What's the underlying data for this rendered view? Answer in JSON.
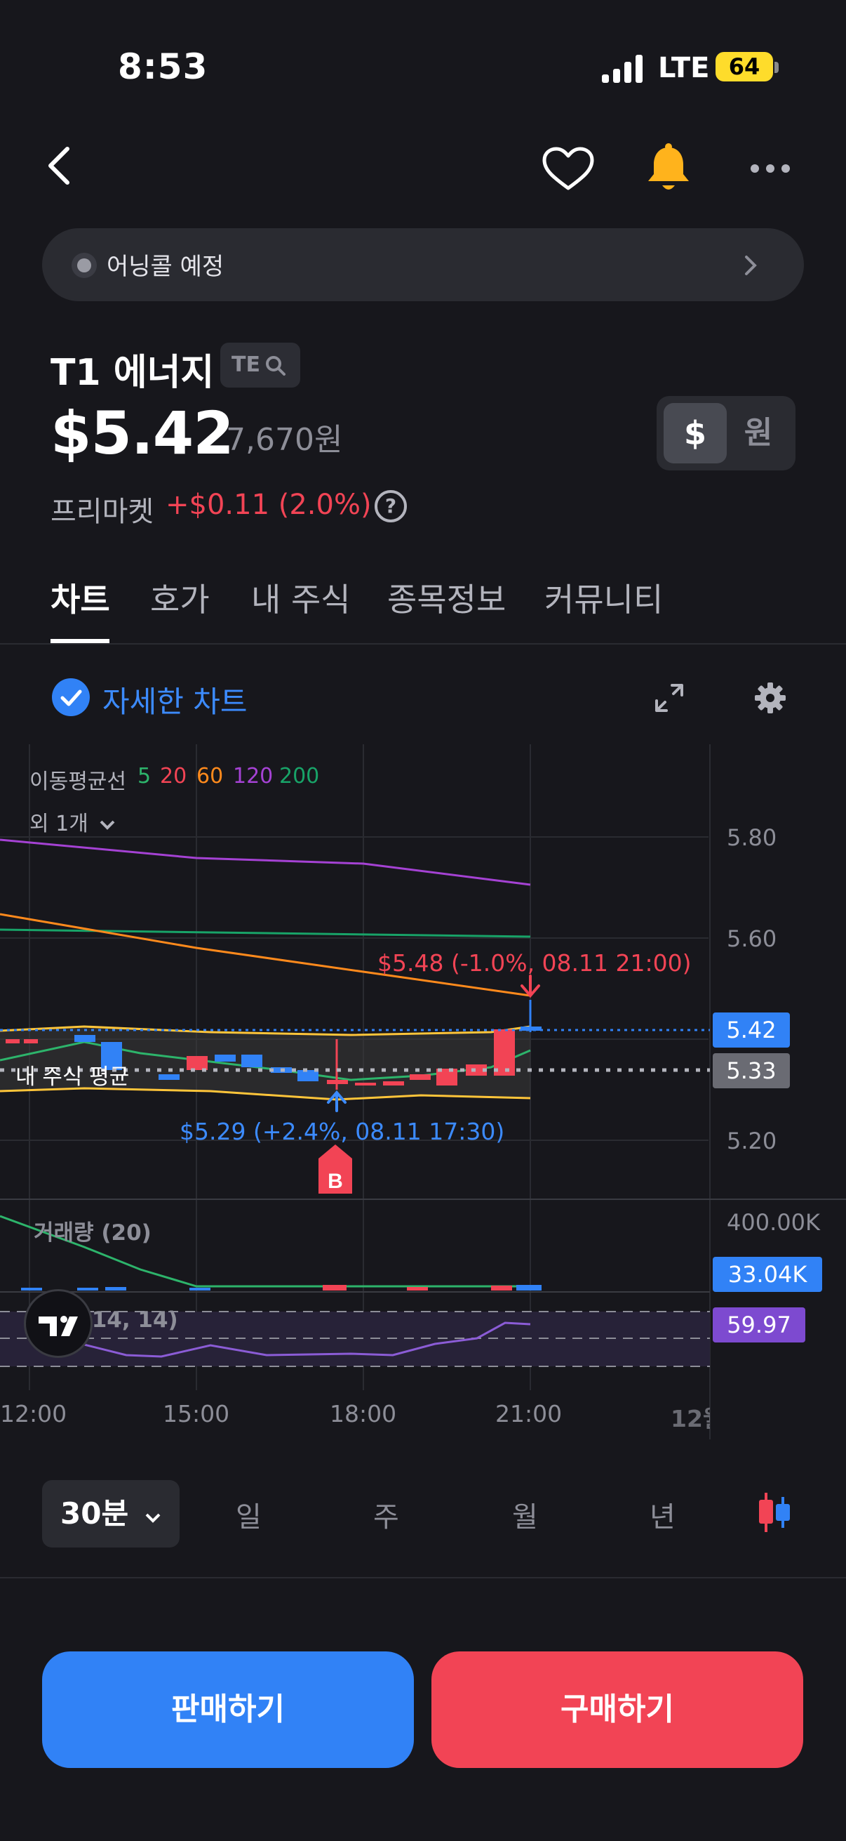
{
  "status_bar": {
    "time": "8:53",
    "network": "LTE",
    "battery": "64"
  },
  "banner": {
    "text": "어닝콜 예정"
  },
  "stock": {
    "name": "T1 에너지",
    "ticker": "TE",
    "price": "$5.42",
    "price_krw": "7,670원",
    "premarket_label": "프리마켓",
    "premarket_change": "+$0.11 (2.0%)"
  },
  "currency": {
    "dollar": "$",
    "won": "원"
  },
  "tabs": [
    {
      "label": "차트"
    },
    {
      "label": "호가"
    },
    {
      "label": "내 주식"
    },
    {
      "label": "종목정보"
    },
    {
      "label": "커뮤니티"
    }
  ],
  "chart_toolbar": {
    "detail_label": "자세한 차트"
  },
  "indicators": {
    "ma_title": "이동평균선",
    "ma_periods": [
      {
        "label": "5",
        "color": "#2db46b"
      },
      {
        "label": "20",
        "color": "#f24455"
      },
      {
        "label": "60",
        "color": "#ff8a1c"
      },
      {
        "label": "120",
        "color": "#a542d4"
      },
      {
        "label": "200",
        "color": "#18a368"
      }
    ],
    "more": "외 1개"
  },
  "chart_data": {
    "type": "candlestick",
    "price_axis": [
      "5.80",
      "5.60",
      "5.20"
    ],
    "current_price_tag": "5.42",
    "avg_price_tag": "5.33",
    "my_avg_label": "내 주식 평균",
    "high_annotation": "$5.48 (-1.0%, 08.11 21:00)",
    "low_annotation": "$5.29 (+2.4%, 08.11 17:30)",
    "buy_marker": "B",
    "volume": {
      "title": "거래량 (20)",
      "axis_max": "400.00K",
      "current_tag": "33.04K"
    },
    "rsi": {
      "title": "RSI (14, 14)",
      "current_tag": "59.97"
    },
    "time_axis": [
      "12:00",
      "15:00",
      "18:00",
      "21:00",
      "12월"
    ],
    "colors": {
      "up": "#f24455",
      "down": "#3182f6"
    }
  },
  "periods": {
    "selected": "30분",
    "options": [
      "일",
      "주",
      "월",
      "년"
    ]
  },
  "actions": {
    "sell": "판매하기",
    "buy": "구매하기"
  }
}
